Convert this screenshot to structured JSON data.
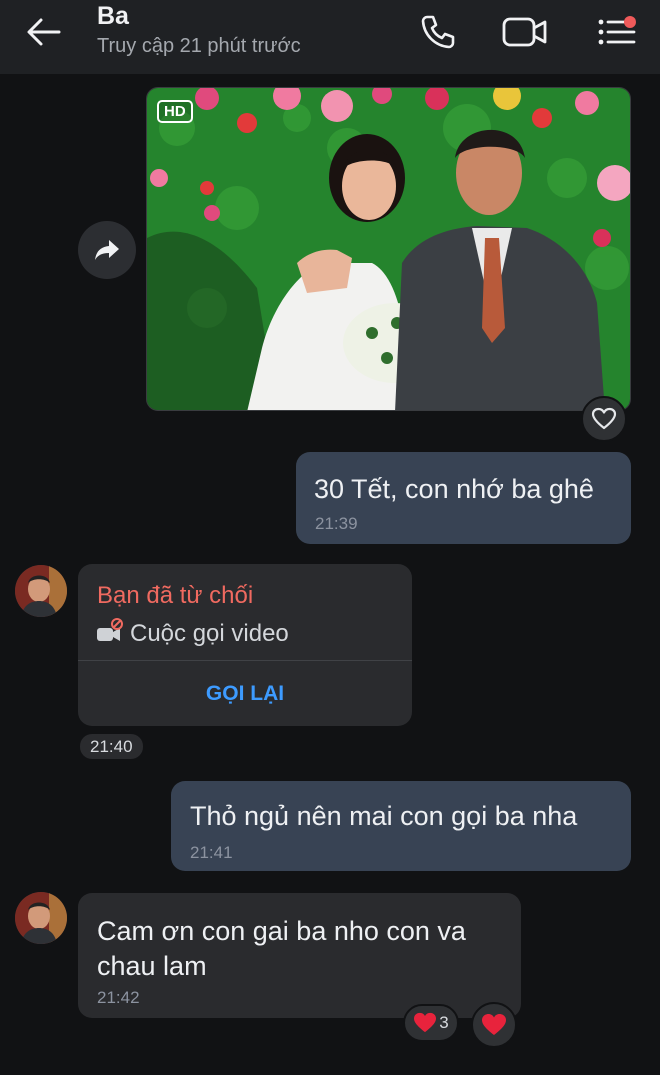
{
  "header": {
    "contact_name": "Ba",
    "status": "Truy cập 21 phút trước",
    "icons": [
      "back-arrow-icon",
      "phone-icon",
      "video-camera-icon",
      "menu-list-icon"
    ],
    "notification_color": "#ef5a5a"
  },
  "messages": {
    "photo": {
      "badge": "HD"
    },
    "m1": {
      "text": "30 Tết, con nhớ ba ghê",
      "time": "21:39"
    },
    "call": {
      "title": "Bạn đã từ chối",
      "subtitle": "Cuộc gọi video",
      "action": "GỌI LẠI",
      "time": "21:40"
    },
    "m2": {
      "text": "Thỏ ngủ nên mai con gọi ba nha",
      "time": "21:41"
    },
    "m3": {
      "text": "Cam ơn con gai ba nho con va chau lam",
      "time": "21:42"
    },
    "reactions": {
      "heart_count": "3"
    }
  },
  "colors": {
    "outgoing_bubble": "#384354",
    "incoming_bubble": "#2a2b2e",
    "declined": "#f06a60",
    "link": "#3d9bff",
    "heart": "#e8233c"
  }
}
